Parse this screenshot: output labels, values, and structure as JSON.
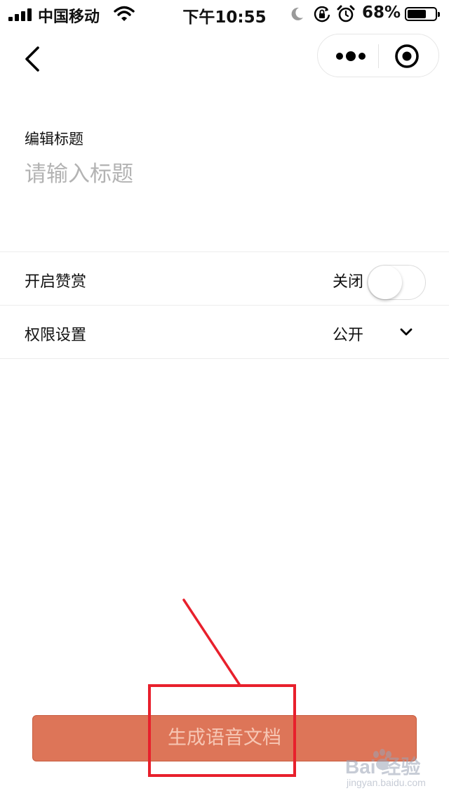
{
  "status_bar": {
    "carrier": "中国移动",
    "time": "下午10:55",
    "battery_percent": "68%",
    "battery_level": 0.68,
    "icons": [
      "signal-icon",
      "wifi-icon",
      "moon-icon",
      "rotation-lock-icon",
      "alarm-icon",
      "battery-icon"
    ]
  },
  "nav": {
    "back_icon": "chevron-left-icon",
    "capsule_icons": [
      "more-dots-icon",
      "close-target-icon"
    ]
  },
  "title_section": {
    "label": "编辑标题",
    "input_value": "",
    "input_placeholder": "请输入标题"
  },
  "settings": {
    "reward": {
      "label": "开启赞赏",
      "value": "关闭",
      "toggle_on": false
    },
    "permission": {
      "label": "权限设置",
      "value": "公开"
    }
  },
  "generate_button": {
    "label": "生成语音文档"
  },
  "watermark": {
    "brand": "Bai  经验",
    "url": "jingyan.baidu.com"
  },
  "colors": {
    "button_bg": "#dd7558",
    "button_text": "#f6c6b4",
    "annotation_red": "#e8202c",
    "placeholder": "#b3b3b3"
  }
}
